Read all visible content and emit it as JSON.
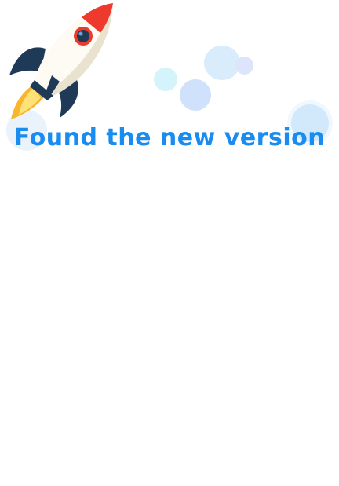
{
  "dialog": {
    "title": "Found the new version"
  },
  "colors": {
    "title_blue": "#1a8cf0",
    "rocket_body": "#fdfbf3",
    "rocket_nose": "#ee3a2c",
    "rocket_fins": "#1f3a57",
    "flame": "#f8b62d"
  },
  "icons": {
    "hero": "rocket-icon"
  }
}
